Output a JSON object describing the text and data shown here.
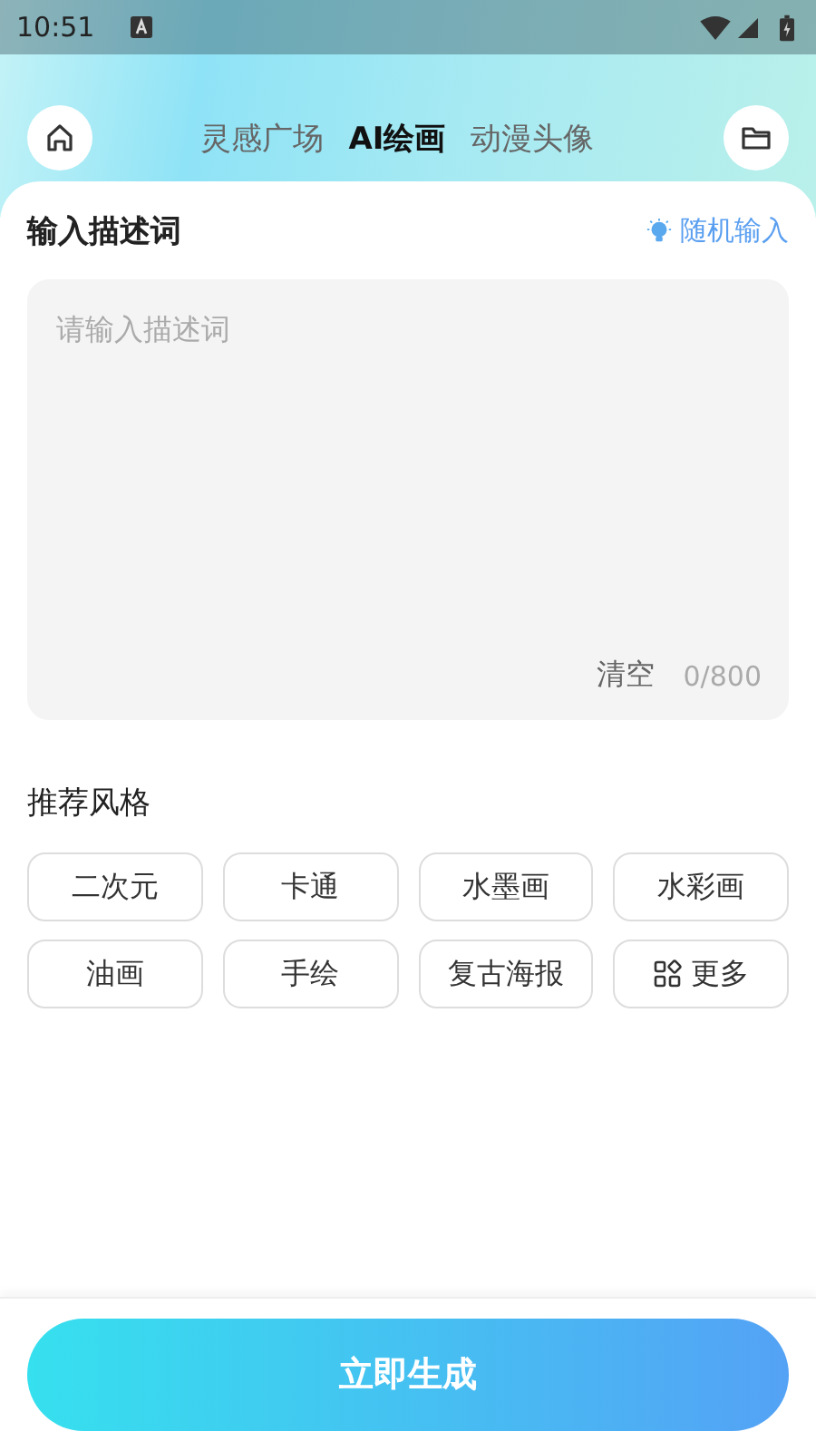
{
  "status_bar": {
    "time": "10:51"
  },
  "tabs": [
    {
      "label": "灵感广场",
      "selected": false
    },
    {
      "label": "AI绘画",
      "selected": true
    },
    {
      "label": "动漫头像",
      "selected": false
    }
  ],
  "prompt": {
    "title": "输入描述词",
    "random_label": "随机输入",
    "placeholder": "请输入描述词",
    "clear_label": "清空",
    "counter": "0/800"
  },
  "styles": {
    "title": "推荐风格",
    "items": [
      {
        "label": "二次元",
        "kind": "style"
      },
      {
        "label": "卡通",
        "kind": "style"
      },
      {
        "label": "水墨画",
        "kind": "style"
      },
      {
        "label": "水彩画",
        "kind": "style"
      },
      {
        "label": "油画",
        "kind": "style"
      },
      {
        "label": "手绘",
        "kind": "style"
      },
      {
        "label": "复古海报",
        "kind": "style"
      },
      {
        "label": "更多",
        "kind": "more"
      }
    ]
  },
  "generate_button": "立即生成"
}
